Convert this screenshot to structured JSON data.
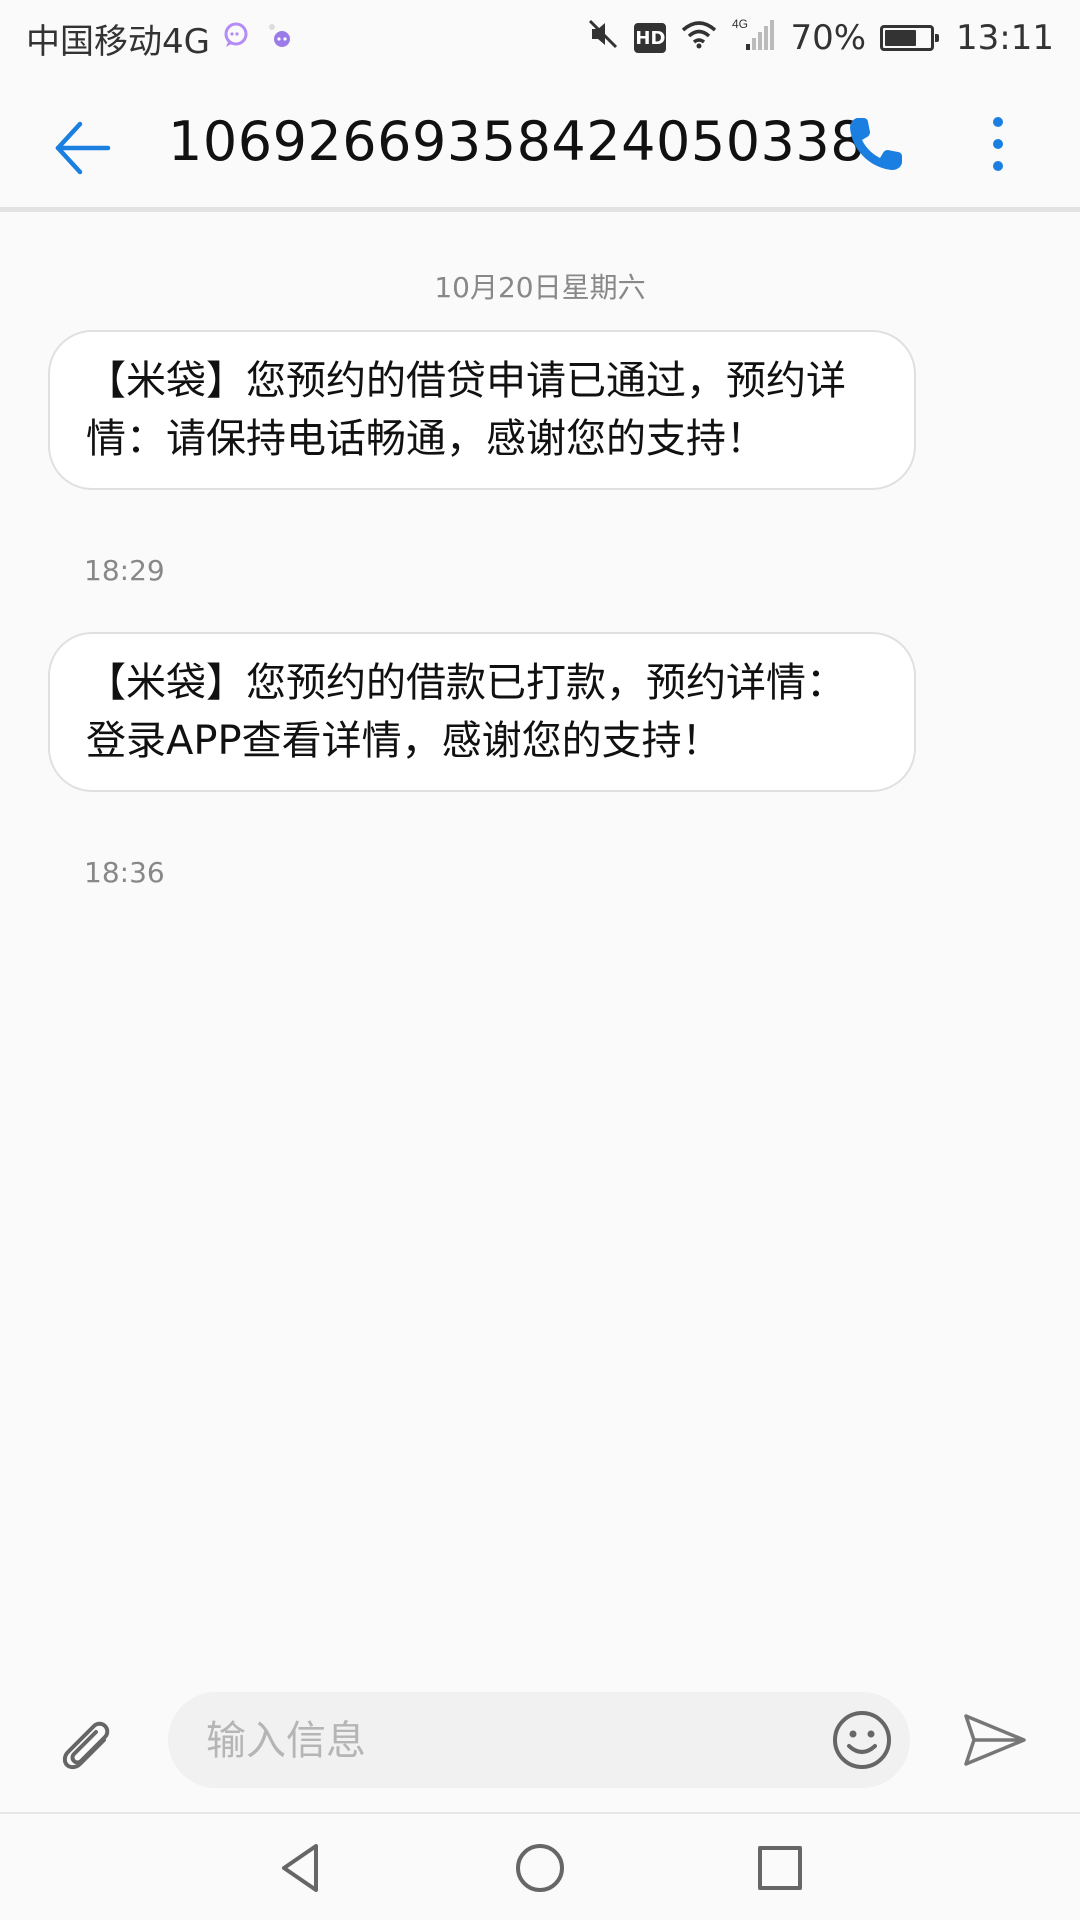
{
  "status_bar": {
    "carrier": "中国移动4G",
    "network": "4G",
    "battery_percent": "70%",
    "battery_level": 0.7,
    "time": "13:11",
    "icons": [
      "chat-bubble-icon",
      "cloud-app-icon",
      "mute-icon",
      "hd-icon",
      "wifi-icon",
      "signal-icon",
      "battery-icon"
    ]
  },
  "app_bar": {
    "title": "1069266935842405033​8",
    "icons": [
      "back-arrow-icon",
      "phone-icon",
      "more-vert-icon"
    ]
  },
  "conversation": {
    "date_separator": "10月20日星期六",
    "messages": [
      {
        "text": "【米袋】您预约的借贷申请已通过，预约详情：请保持电话畅通，感谢您的支持！",
        "time": "18:29"
      },
      {
        "text": "【米袋】您预约的借款已打款，预约详情：登录APP查看详情，感谢您的支持！",
        "time": "18:36"
      }
    ]
  },
  "compose": {
    "placeholder": "输入信息",
    "value": "",
    "icons": [
      "paperclip-icon",
      "emoji-icon",
      "send-icon"
    ]
  },
  "nav_bar": {
    "icons": [
      "nav-back-icon",
      "nav-home-icon",
      "nav-recents-icon"
    ]
  },
  "colors": {
    "accent": "#1a7fe0",
    "bubble_bg": "#ffffff",
    "bubble_border": "#e0e0e0",
    "background": "#fafafa",
    "muted_text": "#888888"
  }
}
